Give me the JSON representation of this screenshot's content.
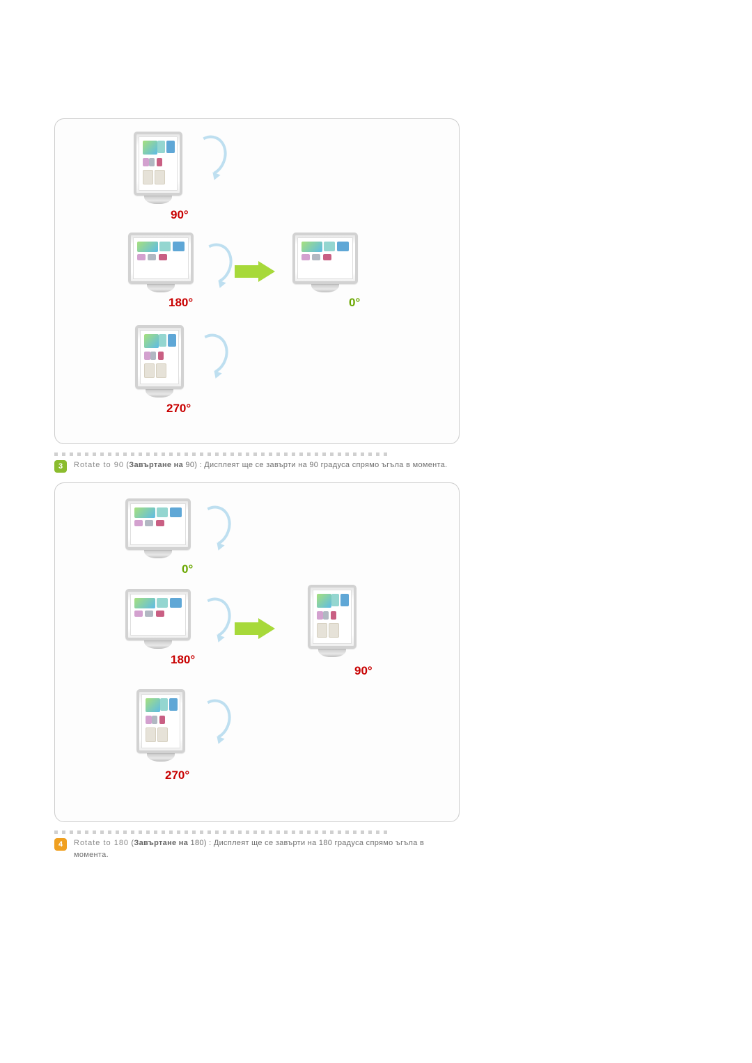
{
  "items": [
    {
      "badge": "3",
      "lead_en": "Rotate to 90",
      "lead_bg": "Завъртане на",
      "lead_val": "90",
      "desc": ": Дисплеят ще се завърти на 90 градуса спрямо ъгъла в момента."
    },
    {
      "badge": "4",
      "lead_en": "Rotate to 180",
      "lead_bg": "Завъртане на",
      "lead_val": "180",
      "desc": ": Дисплеят ще се завърти на 180 градуса спрямо ъгъла в момента."
    }
  ],
  "diagram1": {
    "lbl_top": "90°",
    "lbl_mid_l": "180°",
    "lbl_mid_r": "0°",
    "lbl_bot": "270°"
  },
  "diagram2": {
    "lbl_top": "0°",
    "lbl_mid_l": "180°",
    "lbl_mid_r": "90°",
    "lbl_bot": "270°"
  }
}
